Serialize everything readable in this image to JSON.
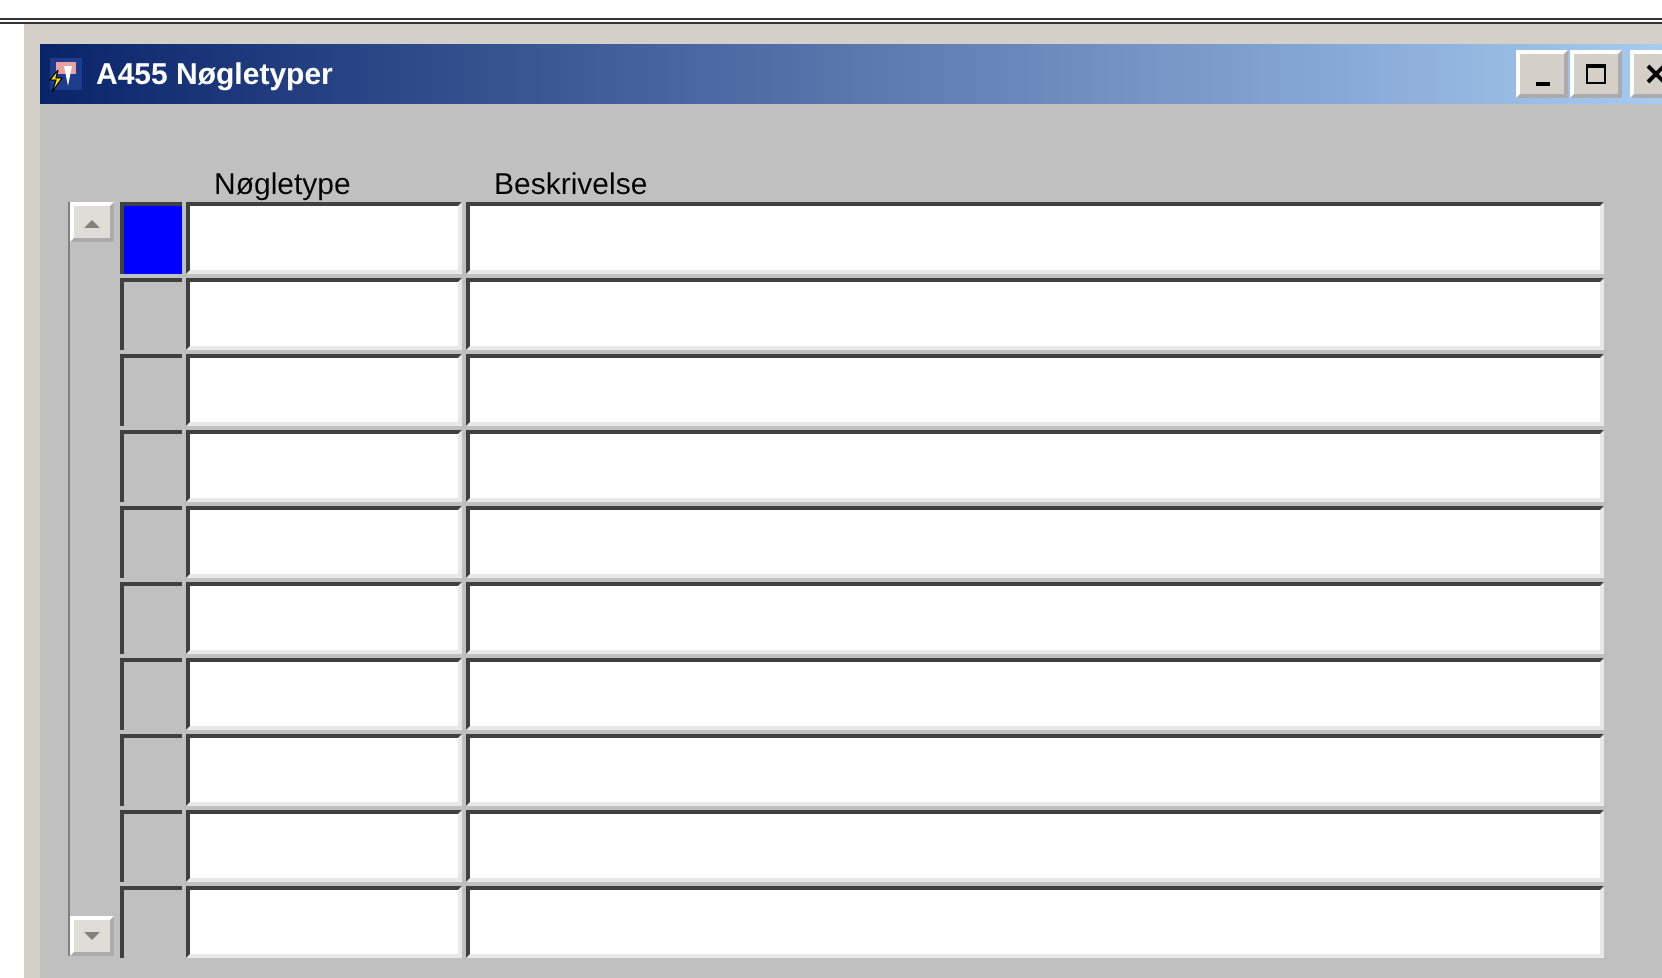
{
  "window": {
    "title": "A455 Nøgletyper"
  },
  "table": {
    "columns": [
      "Nøgletype",
      "Beskrivelse"
    ],
    "rows": [
      {
        "selected": true
      },
      {
        "selected": false
      },
      {
        "selected": false
      },
      {
        "selected": false
      },
      {
        "selected": false
      },
      {
        "selected": false
      },
      {
        "selected": false
      },
      {
        "selected": false
      },
      {
        "selected": false
      },
      {
        "selected": false
      }
    ]
  }
}
